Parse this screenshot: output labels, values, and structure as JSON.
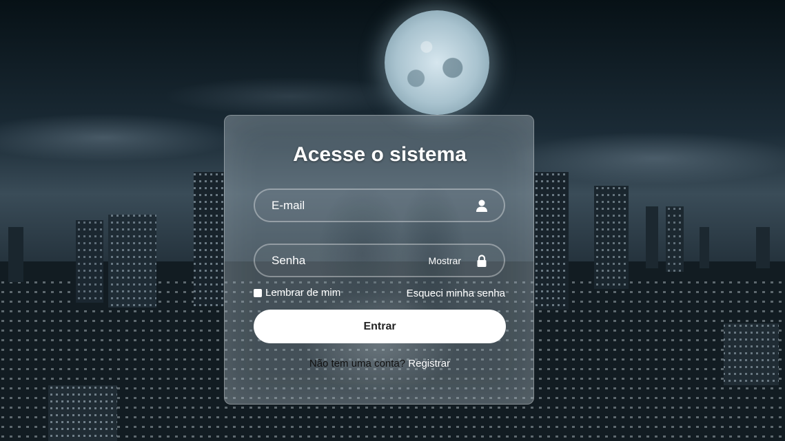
{
  "login": {
    "title": "Acesse o sistema",
    "email": {
      "placeholder": "E-mail",
      "icon": "user-icon"
    },
    "password": {
      "placeholder": "Senha",
      "toggle_label": "Mostrar",
      "icon": "lock-icon"
    },
    "remember_label": "Lembrar de mim",
    "forgot_label": "Esqueci minha senha",
    "submit_label": "Entrar",
    "register_prompt": "Não tem uma conta?",
    "register_link": "Registrar"
  },
  "colors": {
    "panel": "#96a5af",
    "button_bg": "#ffffff",
    "text": "#ffffff"
  }
}
